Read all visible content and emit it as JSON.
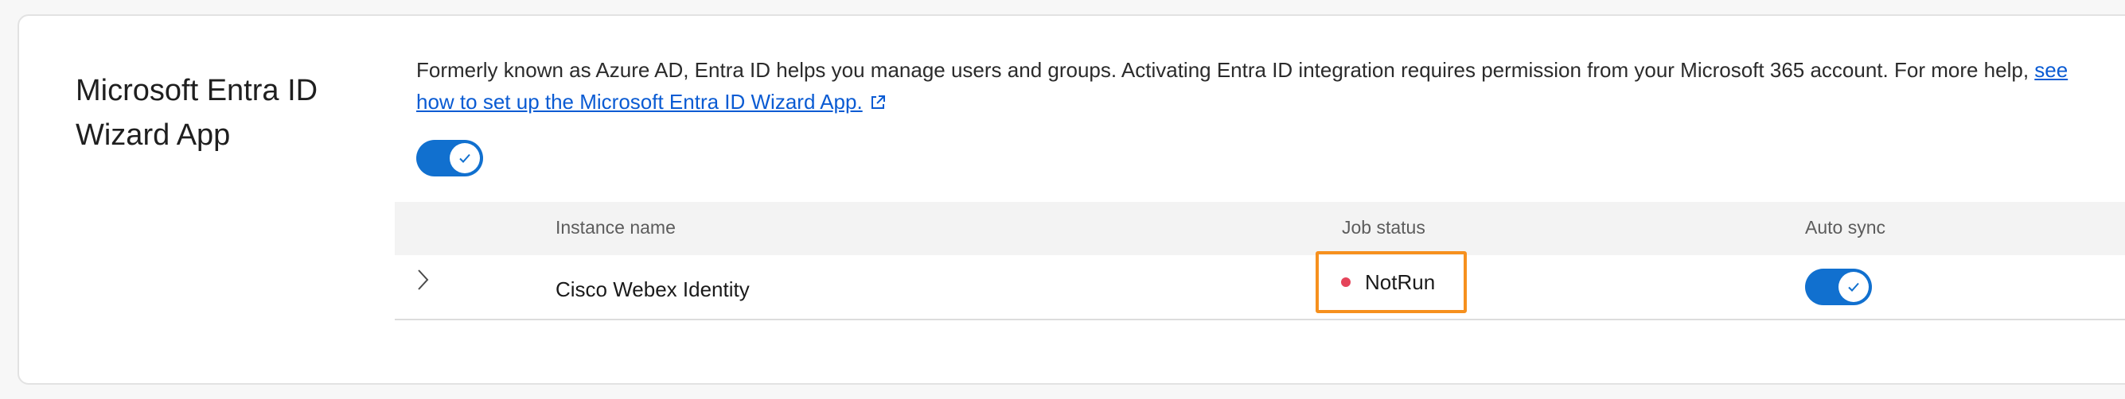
{
  "section": {
    "title": "Microsoft Entra ID Wizard App",
    "description": "Formerly known as Azure AD, Entra ID helps you manage users and groups. Activating Entra ID integration requires permission from your Microsoft 365 account. For more help, ",
    "help_link": "see how to set up the Microsoft Entra ID Wizard App.",
    "integration_enabled": true
  },
  "table": {
    "columns": [
      "Instance name",
      "Job status",
      "Auto sync"
    ],
    "rows": [
      {
        "instance_name": "Cisco Webex Identity",
        "job_status": "NotRun",
        "auto_sync": true
      }
    ]
  },
  "icons": {
    "external_link": "external-link-icon",
    "check": "check-icon",
    "expand": "chevron-right-icon"
  },
  "colors": {
    "accent": "#1170cf",
    "link": "#0a5bd3",
    "status_dot": "#e5445a",
    "highlight_border": "#f6901e"
  }
}
